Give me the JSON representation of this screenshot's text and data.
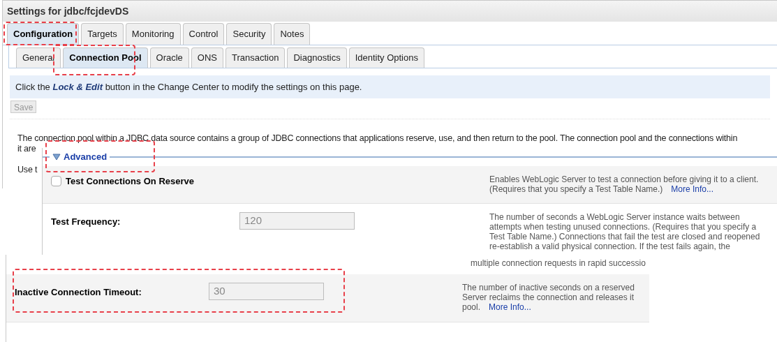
{
  "window": {
    "title": "Settings for jdbc/fcjdevDS"
  },
  "tabs": [
    {
      "label": "Configuration",
      "selected": true
    },
    {
      "label": "Targets",
      "selected": false
    },
    {
      "label": "Monitoring",
      "selected": false
    },
    {
      "label": "Control",
      "selected": false
    },
    {
      "label": "Security",
      "selected": false
    },
    {
      "label": "Notes",
      "selected": false
    }
  ],
  "subtabs": [
    {
      "label": "General",
      "selected": false
    },
    {
      "label": "Connection Pool",
      "selected": true
    },
    {
      "label": "Oracle",
      "selected": false
    },
    {
      "label": "ONS",
      "selected": false
    },
    {
      "label": "Transaction",
      "selected": false
    },
    {
      "label": "Diagnostics",
      "selected": false
    },
    {
      "label": "Identity Options",
      "selected": false
    }
  ],
  "notice": {
    "before": "Click the",
    "emphasis": "Lock & Edit",
    "after": "button in the Change Center to modify the settings on this page."
  },
  "save_button": {
    "label": "Save",
    "disabled": true
  },
  "intro_lines": [
    "The connection pool within a JDBC data source contains a group of JDBC connections that applications reserve, use, and then return to the pool. The connection pool and the connections within",
    "it are",
    "Use t"
  ],
  "advanced": {
    "label": "Advanced",
    "expanded": true
  },
  "settings": [
    {
      "kind": "checkbox",
      "label": "Test Connections On Reserve",
      "checked": false,
      "description": [
        "Enables WebLogic Server to test a connection before giving it to a client.",
        "(Requires that you specify a Test Table Name.)"
      ],
      "more_info": "More Info..."
    },
    {
      "kind": "number",
      "label": "Test Frequency:",
      "value": "120",
      "disabled": true,
      "description": [
        "The number of seconds a WebLogic Server instance waits between",
        "attempts when testing unused connections. (Requires that you specify a",
        "Test Table Name.) Connections that fail the test are closed and reopened",
        "re-establish a valid physical connection. If the test fails again, the"
      ]
    }
  ],
  "lower_panel": {
    "overflow_line": "multiple connection requests in rapid successio",
    "settings": [
      {
        "kind": "number",
        "label": "Inactive Connection Timeout:",
        "value": "30",
        "disabled": true,
        "description": [
          "The number of inactive seconds on a reserved",
          "Server reclaims the connection and releases it",
          "pool."
        ],
        "more_info": "More Info..."
      }
    ]
  }
}
